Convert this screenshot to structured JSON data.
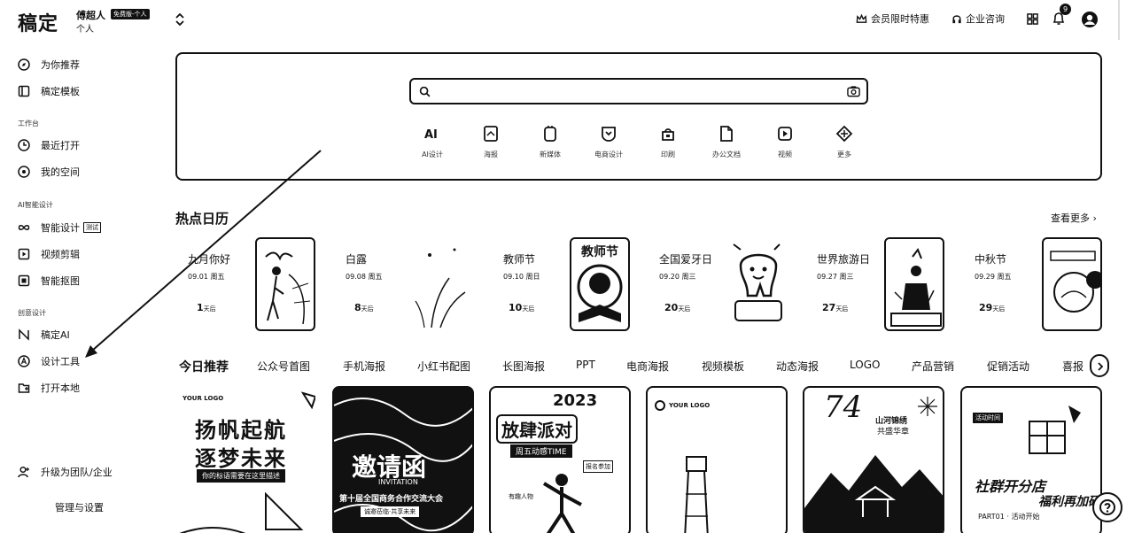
{
  "header": {
    "brand": "稿定",
    "account_name": "傅超人",
    "account_badge": "免费版-个人",
    "account_type": "个人",
    "vip": "会员限时特惠",
    "consult": "企业咨询",
    "notification_count": "9"
  },
  "sidebar": {
    "items_top": [
      {
        "label": "为你推荐",
        "icon": "compass-icon"
      },
      {
        "label": "稿定模板",
        "icon": "template-icon"
      }
    ],
    "section_work": "工作台",
    "items_work": [
      {
        "label": "最近打开",
        "icon": "clock-icon"
      },
      {
        "label": "我的空间",
        "icon": "space-icon"
      }
    ],
    "section_smart": "AI智能设计",
    "items_smart": [
      {
        "label": "智能设计",
        "tag": "测试",
        "icon": "infinity-icon"
      },
      {
        "label": "视频剪辑",
        "icon": "video-icon"
      },
      {
        "label": "智能抠图",
        "icon": "cutout-icon"
      }
    ],
    "section_create": "创意设计",
    "items_create": [
      {
        "label": "稿定AI",
        "icon": "ai-icon"
      },
      {
        "label": "设计工具",
        "icon": "design-tool-icon"
      },
      {
        "label": "打开本地",
        "icon": "open-folder-icon"
      }
    ],
    "upgrade": "升级为团队/企业",
    "settings": "管理与设置"
  },
  "search": {
    "placeholder": "",
    "categories": [
      {
        "label": "AI设计",
        "icon": "ai-text-icon"
      },
      {
        "label": "海报",
        "icon": "poster-icon"
      },
      {
        "label": "新媒体",
        "icon": "media-icon"
      },
      {
        "label": "电商设计",
        "icon": "shop-icon"
      },
      {
        "label": "印刷",
        "icon": "print-icon"
      },
      {
        "label": "办公文档",
        "icon": "doc-icon"
      },
      {
        "label": "视频",
        "icon": "play-icon"
      },
      {
        "label": "更多",
        "icon": "more-icon"
      }
    ]
  },
  "calendar": {
    "title": "热点日历",
    "more": "查看更多",
    "events": [
      {
        "name": "九月你好",
        "date": "09.01 周五",
        "days": "1",
        "unit": "天后"
      },
      {
        "name": "白露",
        "date": "09.08 周五",
        "days": "8",
        "unit": "天后"
      },
      {
        "name": "教师节",
        "date": "09.10 周日",
        "days": "10",
        "unit": "天后",
        "poster": "教师节"
      },
      {
        "name": "全国爱牙日",
        "date": "09.20 周三",
        "days": "20",
        "unit": "天后"
      },
      {
        "name": "世界旅游日",
        "date": "09.27 周三",
        "days": "27",
        "unit": "天后"
      },
      {
        "name": "中秋节",
        "date": "09.29 周五",
        "days": "29",
        "unit": "天后"
      }
    ]
  },
  "recommend": {
    "title": "今日推荐",
    "tabs": [
      "公众号首图",
      "手机海报",
      "小红书配图",
      "长图海报",
      "PPT",
      "电商海报",
      "视频模板",
      "动态海报",
      "LOGO",
      "产品营销",
      "促销活动",
      "喜报"
    ]
  },
  "cards": [
    {
      "logo": "YOUR LOGO",
      "line1": "扬帆起航",
      "line2": "逐梦未来",
      "sub": "你的标语需要在这里描述"
    },
    {
      "line1": "邀请函",
      "en": "INVITATION",
      "sub": "第十届全国商务合作交流大会",
      "sub2": "诚邀莅临·共享未来"
    },
    {
      "year": "2023",
      "line1": "放肆派对",
      "sub": "周五动感TIME",
      "tag": "报名参加",
      "tag2": "有趣人物"
    },
    {
      "logo": "YOUR LOGO"
    },
    {
      "number": "74",
      "sub": "山河锦绣",
      "sub2": "共盛华章"
    },
    {
      "tag": "活动时间",
      "sub": "社群开分店",
      "sub2": "福利再加码",
      "en": "PART01 · 活动开始"
    }
  ]
}
